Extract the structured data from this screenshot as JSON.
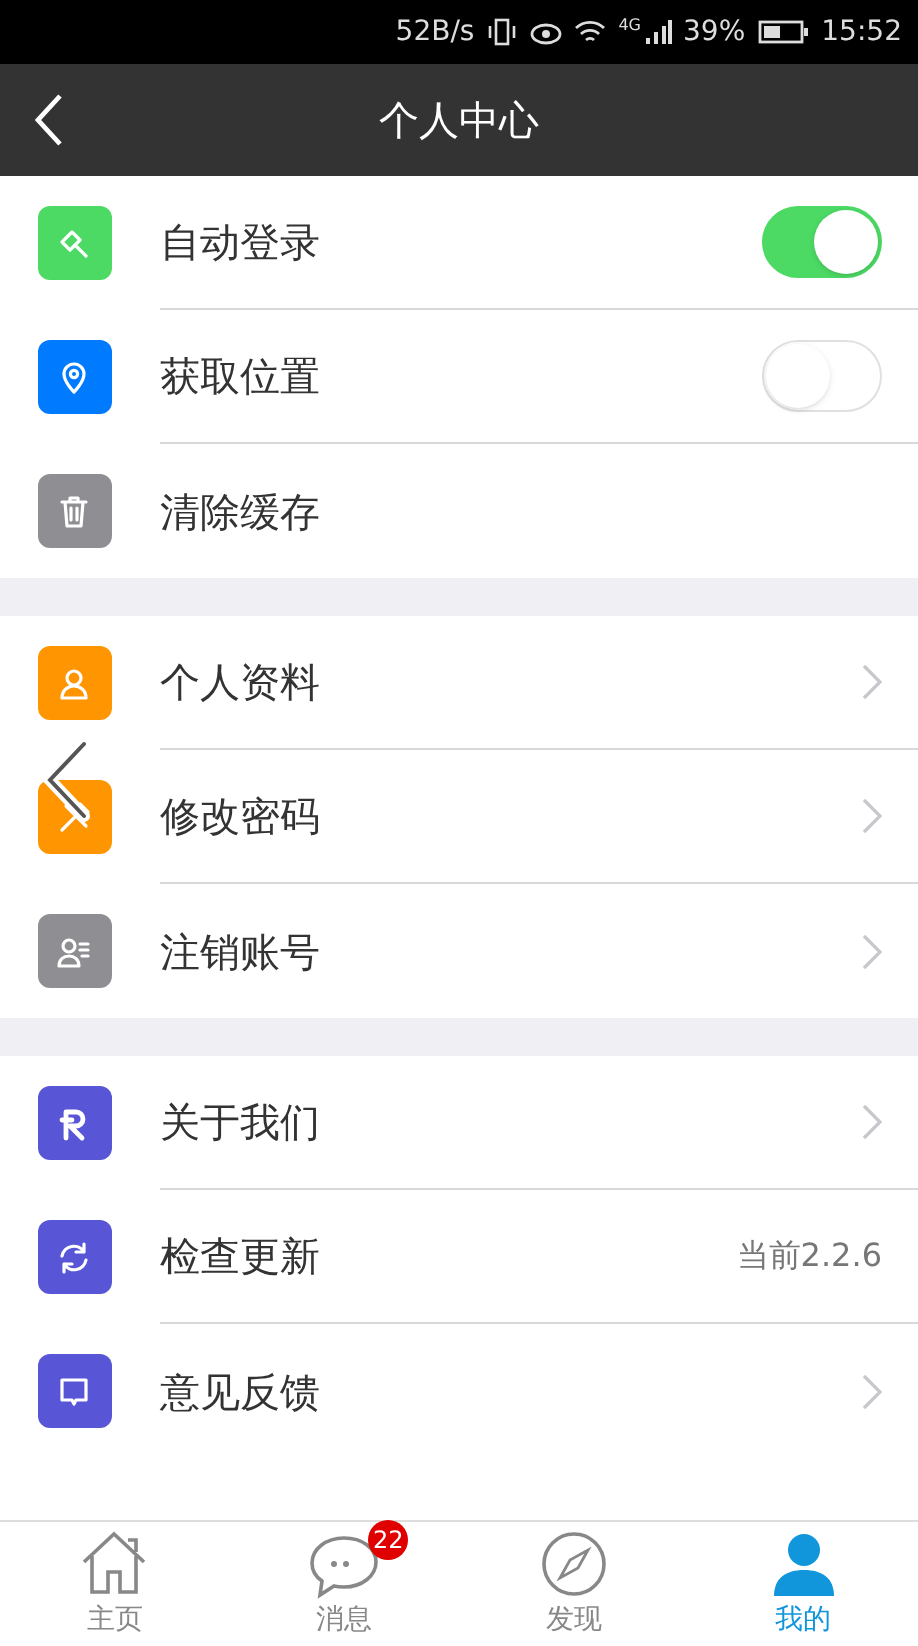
{
  "status_bar": {
    "speed": "52B/s",
    "network": "4G",
    "battery": "39%",
    "time": "15:52"
  },
  "header": {
    "title": "个人中心"
  },
  "sections": [
    {
      "items": [
        {
          "kind": "toggle",
          "label": "自动登录",
          "color": "#4cd964",
          "on": true
        },
        {
          "kind": "toggle",
          "label": "获取位置",
          "color": "#007aff",
          "on": false
        },
        {
          "kind": "plain",
          "label": "清除缓存",
          "color": "#8e8e93"
        }
      ]
    },
    {
      "items": [
        {
          "kind": "link",
          "label": "个人资料",
          "color": "#ff9500"
        },
        {
          "kind": "link",
          "label": "修改密码",
          "color": "#ff9500"
        },
        {
          "kind": "link",
          "label": "注销账号",
          "color": "#8e8e93"
        }
      ]
    },
    {
      "items": [
        {
          "kind": "link",
          "label": "关于我们",
          "color": "#5856d6"
        },
        {
          "kind": "version",
          "label": "检查更新",
          "color": "#5856d6",
          "value": "当前2.2.6"
        },
        {
          "kind": "link",
          "label": "意见反馈",
          "color": "#5856d6"
        }
      ]
    }
  ],
  "tab_bar": [
    {
      "label": "主页",
      "selected": false
    },
    {
      "label": "消息",
      "selected": false,
      "badge": "22"
    },
    {
      "label": "发现",
      "selected": false
    },
    {
      "label": "我的",
      "selected": true
    }
  ]
}
